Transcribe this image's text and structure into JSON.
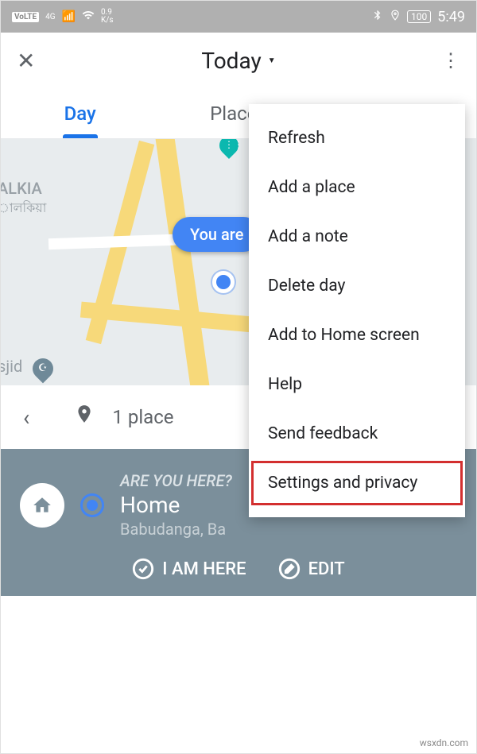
{
  "status": {
    "volte": "VoLTE",
    "net": "4G",
    "speed_num": "0.9",
    "speed_unit": "K/s",
    "battery": "100",
    "time": "5:49"
  },
  "header": {
    "title": "Today"
  },
  "tabs": {
    "day": "Day",
    "places": "Places"
  },
  "map": {
    "area": "ALKIA",
    "area_sub": "ালকিয়া",
    "bottom_area": "sjid",
    "bubble": "You are"
  },
  "placebar": {
    "count": "1 place"
  },
  "card": {
    "question": "ARE YOU HERE?",
    "title": "Home",
    "address": "Babudanga, Ba",
    "action_here": "I AM HERE",
    "action_edit": "EDIT"
  },
  "menu": {
    "refresh": "Refresh",
    "add_place": "Add a place",
    "add_note": "Add a note",
    "delete_day": "Delete day",
    "add_home": "Add to Home screen",
    "help": "Help",
    "feedback": "Send feedback",
    "settings": "Settings and privacy"
  },
  "watermark": "wsxdn.com"
}
